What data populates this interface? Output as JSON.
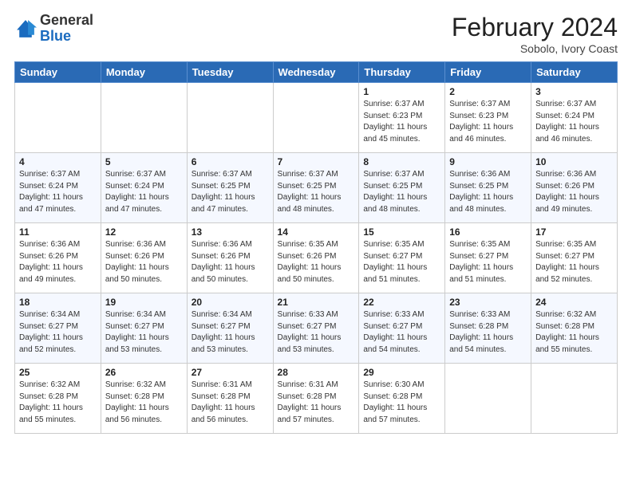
{
  "header": {
    "logo_general": "General",
    "logo_blue": "Blue",
    "title": "February 2024",
    "subtitle": "Sobolo, Ivory Coast"
  },
  "days_of_week": [
    "Sunday",
    "Monday",
    "Tuesday",
    "Wednesday",
    "Thursday",
    "Friday",
    "Saturday"
  ],
  "weeks": [
    [
      {
        "day": "",
        "info": ""
      },
      {
        "day": "",
        "info": ""
      },
      {
        "day": "",
        "info": ""
      },
      {
        "day": "",
        "info": ""
      },
      {
        "day": "1",
        "info": "Sunrise: 6:37 AM\nSunset: 6:23 PM\nDaylight: 11 hours\nand 45 minutes."
      },
      {
        "day": "2",
        "info": "Sunrise: 6:37 AM\nSunset: 6:23 PM\nDaylight: 11 hours\nand 46 minutes."
      },
      {
        "day": "3",
        "info": "Sunrise: 6:37 AM\nSunset: 6:24 PM\nDaylight: 11 hours\nand 46 minutes."
      }
    ],
    [
      {
        "day": "4",
        "info": "Sunrise: 6:37 AM\nSunset: 6:24 PM\nDaylight: 11 hours\nand 47 minutes."
      },
      {
        "day": "5",
        "info": "Sunrise: 6:37 AM\nSunset: 6:24 PM\nDaylight: 11 hours\nand 47 minutes."
      },
      {
        "day": "6",
        "info": "Sunrise: 6:37 AM\nSunset: 6:25 PM\nDaylight: 11 hours\nand 47 minutes."
      },
      {
        "day": "7",
        "info": "Sunrise: 6:37 AM\nSunset: 6:25 PM\nDaylight: 11 hours\nand 48 minutes."
      },
      {
        "day": "8",
        "info": "Sunrise: 6:37 AM\nSunset: 6:25 PM\nDaylight: 11 hours\nand 48 minutes."
      },
      {
        "day": "9",
        "info": "Sunrise: 6:36 AM\nSunset: 6:25 PM\nDaylight: 11 hours\nand 48 minutes."
      },
      {
        "day": "10",
        "info": "Sunrise: 6:36 AM\nSunset: 6:26 PM\nDaylight: 11 hours\nand 49 minutes."
      }
    ],
    [
      {
        "day": "11",
        "info": "Sunrise: 6:36 AM\nSunset: 6:26 PM\nDaylight: 11 hours\nand 49 minutes."
      },
      {
        "day": "12",
        "info": "Sunrise: 6:36 AM\nSunset: 6:26 PM\nDaylight: 11 hours\nand 50 minutes."
      },
      {
        "day": "13",
        "info": "Sunrise: 6:36 AM\nSunset: 6:26 PM\nDaylight: 11 hours\nand 50 minutes."
      },
      {
        "day": "14",
        "info": "Sunrise: 6:35 AM\nSunset: 6:26 PM\nDaylight: 11 hours\nand 50 minutes."
      },
      {
        "day": "15",
        "info": "Sunrise: 6:35 AM\nSunset: 6:27 PM\nDaylight: 11 hours\nand 51 minutes."
      },
      {
        "day": "16",
        "info": "Sunrise: 6:35 AM\nSunset: 6:27 PM\nDaylight: 11 hours\nand 51 minutes."
      },
      {
        "day": "17",
        "info": "Sunrise: 6:35 AM\nSunset: 6:27 PM\nDaylight: 11 hours\nand 52 minutes."
      }
    ],
    [
      {
        "day": "18",
        "info": "Sunrise: 6:34 AM\nSunset: 6:27 PM\nDaylight: 11 hours\nand 52 minutes."
      },
      {
        "day": "19",
        "info": "Sunrise: 6:34 AM\nSunset: 6:27 PM\nDaylight: 11 hours\nand 53 minutes."
      },
      {
        "day": "20",
        "info": "Sunrise: 6:34 AM\nSunset: 6:27 PM\nDaylight: 11 hours\nand 53 minutes."
      },
      {
        "day": "21",
        "info": "Sunrise: 6:33 AM\nSunset: 6:27 PM\nDaylight: 11 hours\nand 53 minutes."
      },
      {
        "day": "22",
        "info": "Sunrise: 6:33 AM\nSunset: 6:27 PM\nDaylight: 11 hours\nand 54 minutes."
      },
      {
        "day": "23",
        "info": "Sunrise: 6:33 AM\nSunset: 6:28 PM\nDaylight: 11 hours\nand 54 minutes."
      },
      {
        "day": "24",
        "info": "Sunrise: 6:32 AM\nSunset: 6:28 PM\nDaylight: 11 hours\nand 55 minutes."
      }
    ],
    [
      {
        "day": "25",
        "info": "Sunrise: 6:32 AM\nSunset: 6:28 PM\nDaylight: 11 hours\nand 55 minutes."
      },
      {
        "day": "26",
        "info": "Sunrise: 6:32 AM\nSunset: 6:28 PM\nDaylight: 11 hours\nand 56 minutes."
      },
      {
        "day": "27",
        "info": "Sunrise: 6:31 AM\nSunset: 6:28 PM\nDaylight: 11 hours\nand 56 minutes."
      },
      {
        "day": "28",
        "info": "Sunrise: 6:31 AM\nSunset: 6:28 PM\nDaylight: 11 hours\nand 57 minutes."
      },
      {
        "day": "29",
        "info": "Sunrise: 6:30 AM\nSunset: 6:28 PM\nDaylight: 11 hours\nand 57 minutes."
      },
      {
        "day": "",
        "info": ""
      },
      {
        "day": "",
        "info": ""
      }
    ]
  ]
}
